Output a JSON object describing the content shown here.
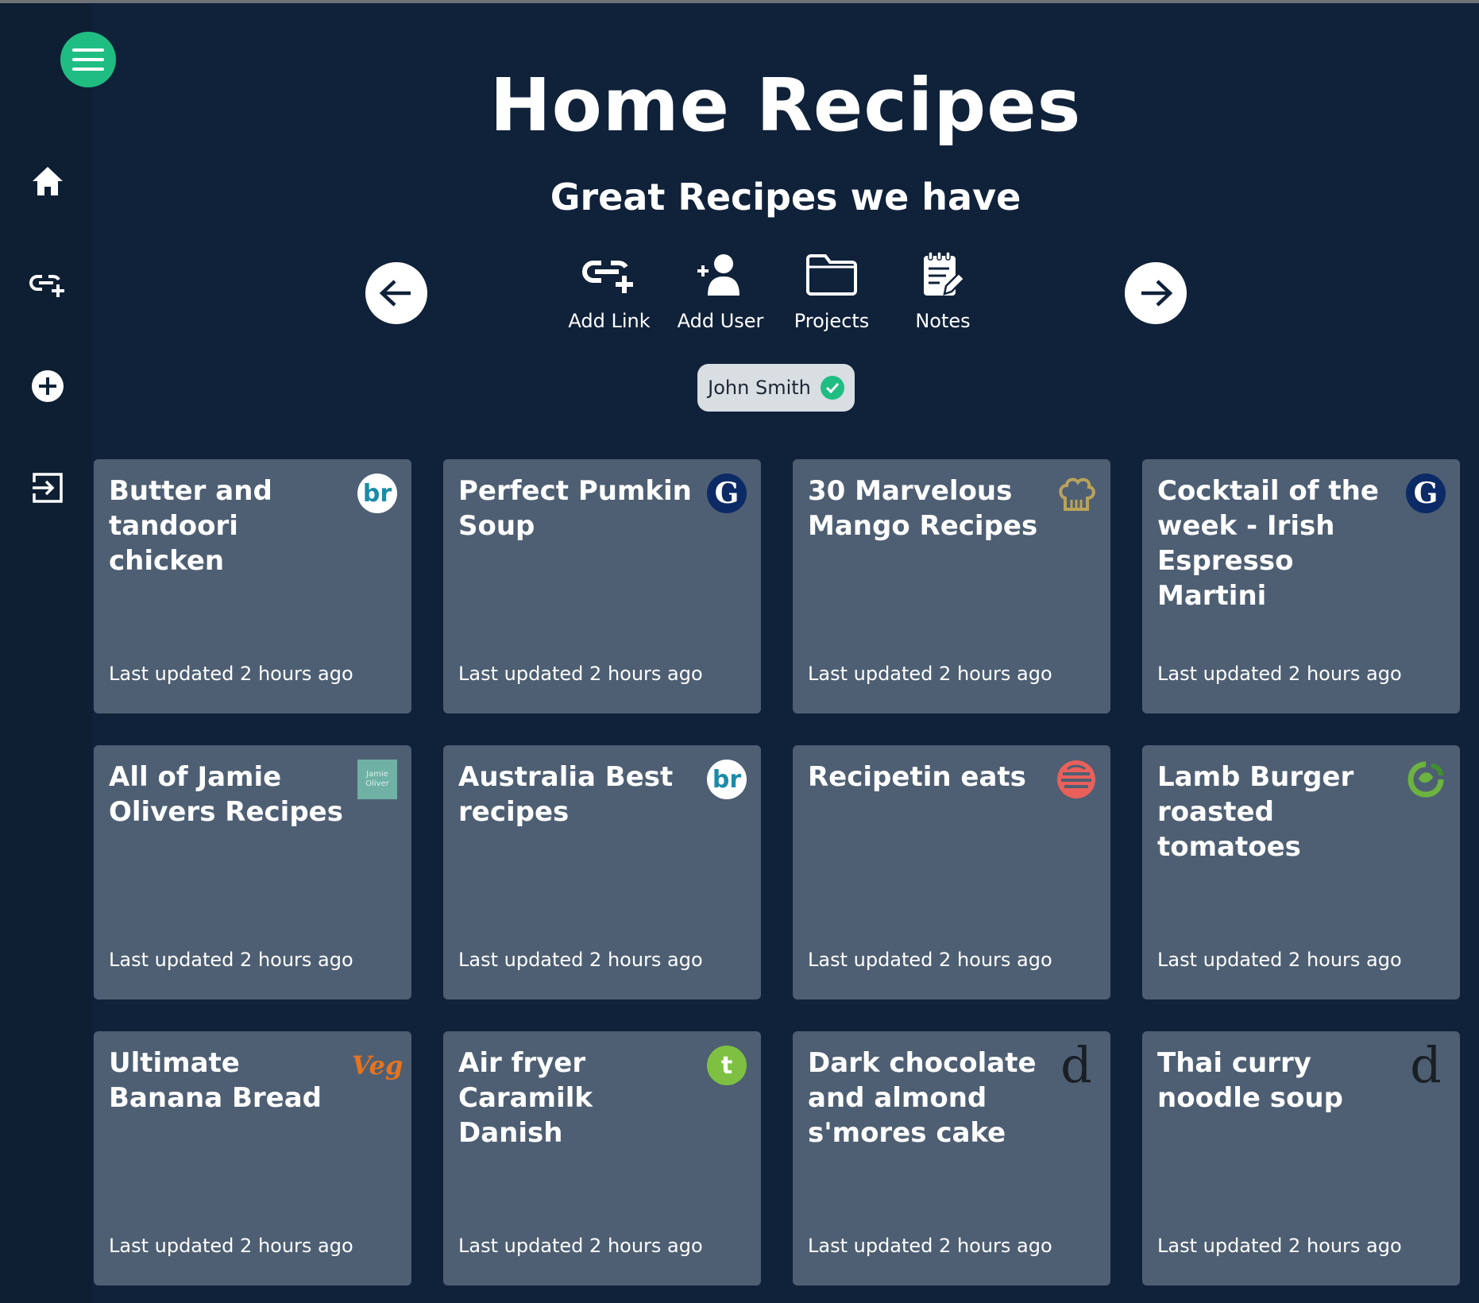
{
  "header": {
    "title": "Home Recipes",
    "subtitle": "Great Recipes we have"
  },
  "sidebar": {
    "items": [
      {
        "icon": "home-icon"
      },
      {
        "icon": "add-link-icon"
      },
      {
        "icon": "plus-circle-icon"
      },
      {
        "icon": "logout-icon"
      }
    ]
  },
  "actions": [
    {
      "label": "Add Link",
      "icon": "add-link-icon"
    },
    {
      "label": "Add User",
      "icon": "add-user-icon"
    },
    {
      "label": "Projects",
      "icon": "folder-icon"
    },
    {
      "label": "Notes",
      "icon": "notes-icon"
    }
  ],
  "user": {
    "name": "John Smith",
    "verified": true
  },
  "cards": [
    {
      "title": "Butter and tandoori chicken",
      "updated": "Last updated 2 hours ago",
      "logo": "br-logo",
      "logo_text": "br"
    },
    {
      "title": "Perfect Pumkin Soup",
      "updated": "Last updated 2 hours ago",
      "logo": "g-logo",
      "logo_text": "G"
    },
    {
      "title": "30 Marvelous Mango Recipes",
      "updated": "Last updated 2 hours ago",
      "logo": "chef-hat-logo",
      "logo_text": ""
    },
    {
      "title": "Cocktail of the week - Irish Espresso Martini",
      "updated": "Last updated 2 hours ago",
      "logo": "g-logo",
      "logo_text": "G"
    },
    {
      "title": "All of Jamie Olivers Recipes",
      "updated": "Last updated 2 hours ago",
      "logo": "jamie-oliver-logo",
      "logo_text": "Jamie Oliver"
    },
    {
      "title": "Australia Best recipes",
      "updated": "Last updated 2 hours ago",
      "logo": "br-logo",
      "logo_text": "br"
    },
    {
      "title": "Recipetin eats",
      "updated": "Last updated 2 hours ago",
      "logo": "recipetin-logo",
      "logo_text": ""
    },
    {
      "title": "Lamb Burger roasted tomatoes",
      "updated": "Last updated 2 hours ago",
      "logo": "woolworths-logo",
      "logo_text": ""
    },
    {
      "title": "Ultimate Banana Bread",
      "updated": "Last updated 2 hours ago",
      "logo": "veg-logo",
      "logo_text": "Veg"
    },
    {
      "title": "Air fryer Caramilk Danish",
      "updated": "Last updated 2 hours ago",
      "logo": "t-logo",
      "logo_text": "t"
    },
    {
      "title": "Dark chocolate and almond s'mores cake",
      "updated": "Last updated 2 hours ago",
      "logo": "d-logo",
      "logo_text": "d"
    },
    {
      "title": "Thai curry noodle soup",
      "updated": "Last updated 2 hours ago",
      "logo": "d-logo",
      "logo_text": "d"
    }
  ],
  "colors": {
    "background": "#10223a",
    "sidebar": "#0e1f33",
    "accent": "#20bd82",
    "card": "#4e5f73",
    "chip": "#d9dee3"
  }
}
